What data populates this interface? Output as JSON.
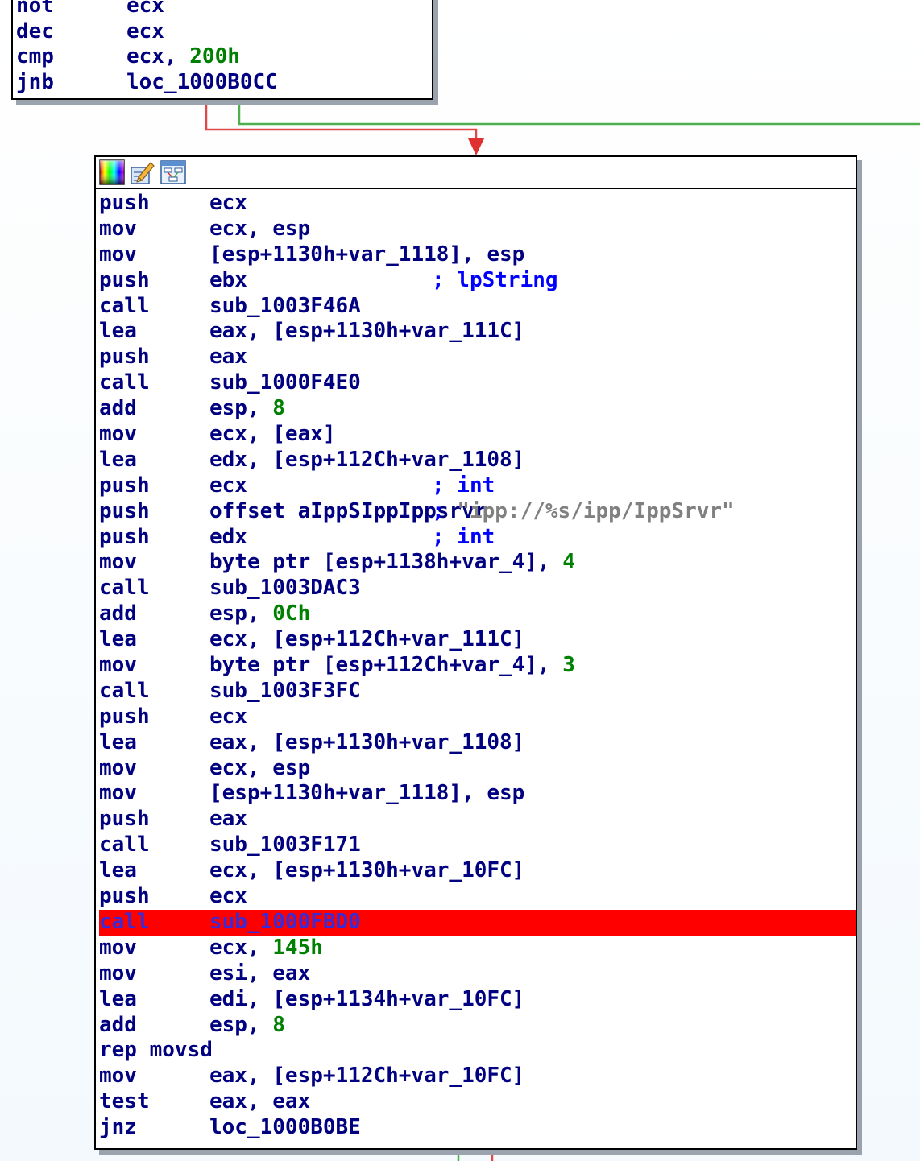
{
  "colors": {
    "block_border": "#000000",
    "text_navy": "#000080",
    "comment_blue": "#0000ff",
    "string_gray": "#808080",
    "number_green": "#008000",
    "highlight_red": "#ff0000",
    "edge_false": "#e04848",
    "edge_true": "#50b050",
    "shadow": "#9aa3ad"
  },
  "top_block": {
    "lines": [
      {
        "mn": "not",
        "op": "ecx"
      },
      {
        "mn": "dec",
        "op": "ecx"
      },
      {
        "mn": "cmp",
        "op_parts": [
          {
            "t": "ecx, "
          },
          {
            "t": "200h",
            "c": "num"
          }
        ]
      },
      {
        "mn": "jnb",
        "op": "loc_1000B0CC"
      }
    ]
  },
  "main_block": {
    "titlebar_icons": [
      "color-palette-icon",
      "edit-pencil-icon",
      "graph-view-icon"
    ],
    "lines": [
      {
        "mn": "push",
        "op": "ecx"
      },
      {
        "mn": "mov",
        "op": "ecx, esp"
      },
      {
        "mn": "mov",
        "op": "[esp+1130h+var_1118], esp"
      },
      {
        "mn": "push",
        "op": "ebx",
        "cm": "; lpString"
      },
      {
        "mn": "call",
        "op": "sub_1003F46A"
      },
      {
        "mn": "lea",
        "op": "eax, [esp+1130h+var_111C]"
      },
      {
        "mn": "push",
        "op": "eax"
      },
      {
        "mn": "call",
        "op": "sub_1000F4E0"
      },
      {
        "mn": "add",
        "op_parts": [
          {
            "t": "esp, "
          },
          {
            "t": "8",
            "c": "num"
          }
        ]
      },
      {
        "mn": "mov",
        "op": "ecx, [eax]"
      },
      {
        "mn": "lea",
        "op": "edx, [esp+112Ch+var_1108]"
      },
      {
        "mn": "push",
        "op": "ecx",
        "cm": "; int"
      },
      {
        "mn": "push",
        "op": "offset aIppSIppIppsrvr",
        "cm_parts": [
          {
            "t": "; "
          },
          {
            "t": "\"ipp://%s/ipp/IppSrvr\"",
            "c": "str"
          }
        ]
      },
      {
        "mn": "push",
        "op": "edx",
        "cm": "; int"
      },
      {
        "mn": "mov",
        "op_parts": [
          {
            "t": "byte ptr [esp+1138h+var_4], "
          },
          {
            "t": "4",
            "c": "num"
          }
        ]
      },
      {
        "mn": "call",
        "op": "sub_1003DAC3"
      },
      {
        "mn": "add",
        "op_parts": [
          {
            "t": "esp, "
          },
          {
            "t": "0Ch",
            "c": "num"
          }
        ]
      },
      {
        "mn": "lea",
        "op": "ecx, [esp+112Ch+var_111C]"
      },
      {
        "mn": "mov",
        "op_parts": [
          {
            "t": "byte ptr [esp+112Ch+var_4], "
          },
          {
            "t": "3",
            "c": "num"
          }
        ]
      },
      {
        "mn": "call",
        "op": "sub_1003F3FC"
      },
      {
        "mn": "push",
        "op": "ecx"
      },
      {
        "mn": "lea",
        "op": "eax, [esp+1130h+var_1108]"
      },
      {
        "mn": "mov",
        "op": "ecx, esp"
      },
      {
        "mn": "mov",
        "op": "[esp+1130h+var_1118], esp"
      },
      {
        "mn": "push",
        "op": "eax"
      },
      {
        "mn": "call",
        "op": "sub_1003F171"
      },
      {
        "mn": "lea",
        "op": "ecx, [esp+1130h+var_10FC]"
      },
      {
        "mn": "push",
        "op": "ecx"
      },
      {
        "mn": "call",
        "op": "sub_1000FBD0",
        "highlight": true
      },
      {
        "mn": "mov",
        "op_parts": [
          {
            "t": "ecx, "
          },
          {
            "t": "145h",
            "c": "num"
          }
        ]
      },
      {
        "mn": "mov",
        "op": "esi, eax"
      },
      {
        "mn": "lea",
        "op": "edi, [esp+1134h+var_10FC]"
      },
      {
        "mn": "add",
        "op_parts": [
          {
            "t": "esp, "
          },
          {
            "t": "8",
            "c": "num"
          }
        ]
      },
      {
        "mn": "rep movsd",
        "op": ""
      },
      {
        "mn": "mov",
        "op": "eax, [esp+112Ch+var_10FC]"
      },
      {
        "mn": "test",
        "op": "eax, eax"
      },
      {
        "mn": "jnz",
        "op": "loc_1000B0BE"
      }
    ]
  }
}
